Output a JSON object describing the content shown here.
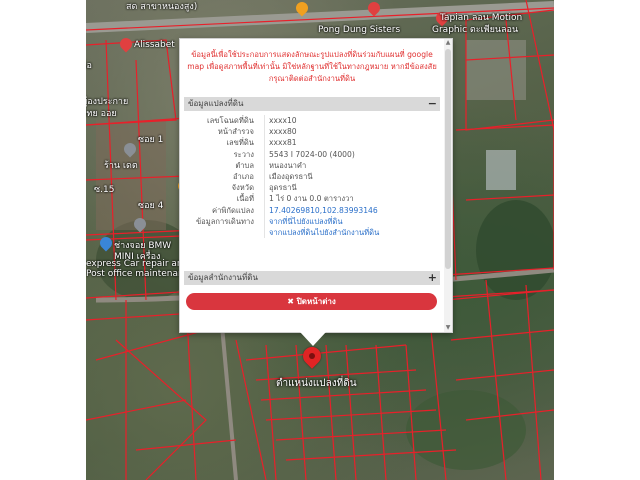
{
  "map": {
    "labels": [
      {
        "text": "สด สาขาหนองสูง)",
        "id": "top-left-store"
      },
      {
        "text": "Alissabet",
        "id": "alissabet"
      },
      {
        "text": "Pong Dung Sisters",
        "id": "pong-dung"
      },
      {
        "text": "Tapian ลอน Motion",
        "id": "tapian"
      },
      {
        "text": "Graphic ตะเพียนลอน",
        "id": "graphic"
      },
      {
        "text": "ผู้องประกาย",
        "id": "left-road"
      },
      {
        "text": "ไทย ออย",
        "id": "left-road-2"
      },
      {
        "text": "ซอย 1",
        "id": "soi1"
      },
      {
        "text": "ร้าน เดต",
        "id": "shop"
      },
      {
        "text": "ซ.15",
        "id": "soi15"
      },
      {
        "text": "ซอย 4",
        "id": "soi4"
      },
      {
        "text": "ช่างจอย BMW",
        "id": "bmw1"
      },
      {
        "text": "MINI เครื่อง",
        "id": "bmw2"
      },
      {
        "text": "express Car repair and",
        "id": "bmw3"
      },
      {
        "text": "Post office maintenance s",
        "id": "bmw4"
      },
      {
        "text": "ไอ",
        "id": "left-edge"
      }
    ],
    "marker_label": "ตำแหน่งแปลงที่ดิน"
  },
  "popup": {
    "notice": "ข้อมูลนี้เพื่อใช้ประกอบการแสดงลักษณะรูปแปลงที่ดินร่วมกับแผนที่ google map เพื่อดูสภาพพื้นที่เท่านั้น มิใช่หลักฐานที่ใช้ในทางกฎหมาย หากมีข้อสงสัย กรุณาติดต่อสำนักงานที่ดิน",
    "section1_title": "ข้อมูลแปลงที่ดิน",
    "section1_toggle": "−",
    "rows": [
      {
        "label": "เลขโฉนดที่ดิน",
        "value": "xxxx10"
      },
      {
        "label": "หน้าสำรวจ",
        "value": "xxxx80"
      },
      {
        "label": "เลขที่ดิน",
        "value": "xxxx81"
      },
      {
        "label": "ระวาง",
        "value": "5543 I 7024-00 (4000)"
      },
      {
        "label": "ตำบล",
        "value": "หนองนาคำ"
      },
      {
        "label": "อำเภอ",
        "value": "เมืองอุดรธานี"
      },
      {
        "label": "จังหวัด",
        "value": "อุดรธานี"
      },
      {
        "label": "เนื้อที่",
        "value": "1 ไร่ 0 งาน 0.0 ตารางวา"
      },
      {
        "label": "ค่าพิกัดแปลง",
        "value": "17.40269810,102.83993146",
        "link": true
      },
      {
        "label": "ข้อมูลการเดินทาง",
        "value": "จากที่นี่ไปยังแปลงที่ดิน",
        "link": true
      },
      {
        "label": "",
        "value": "จากแปลงที่ดินไปยังสำนักงานที่ดิน",
        "link": true
      }
    ],
    "section2_title": "ข้อมูลสำนักงานที่ดิน",
    "section2_toggle": "+",
    "close_label": "✖ ปิดหน้าต่าง"
  }
}
